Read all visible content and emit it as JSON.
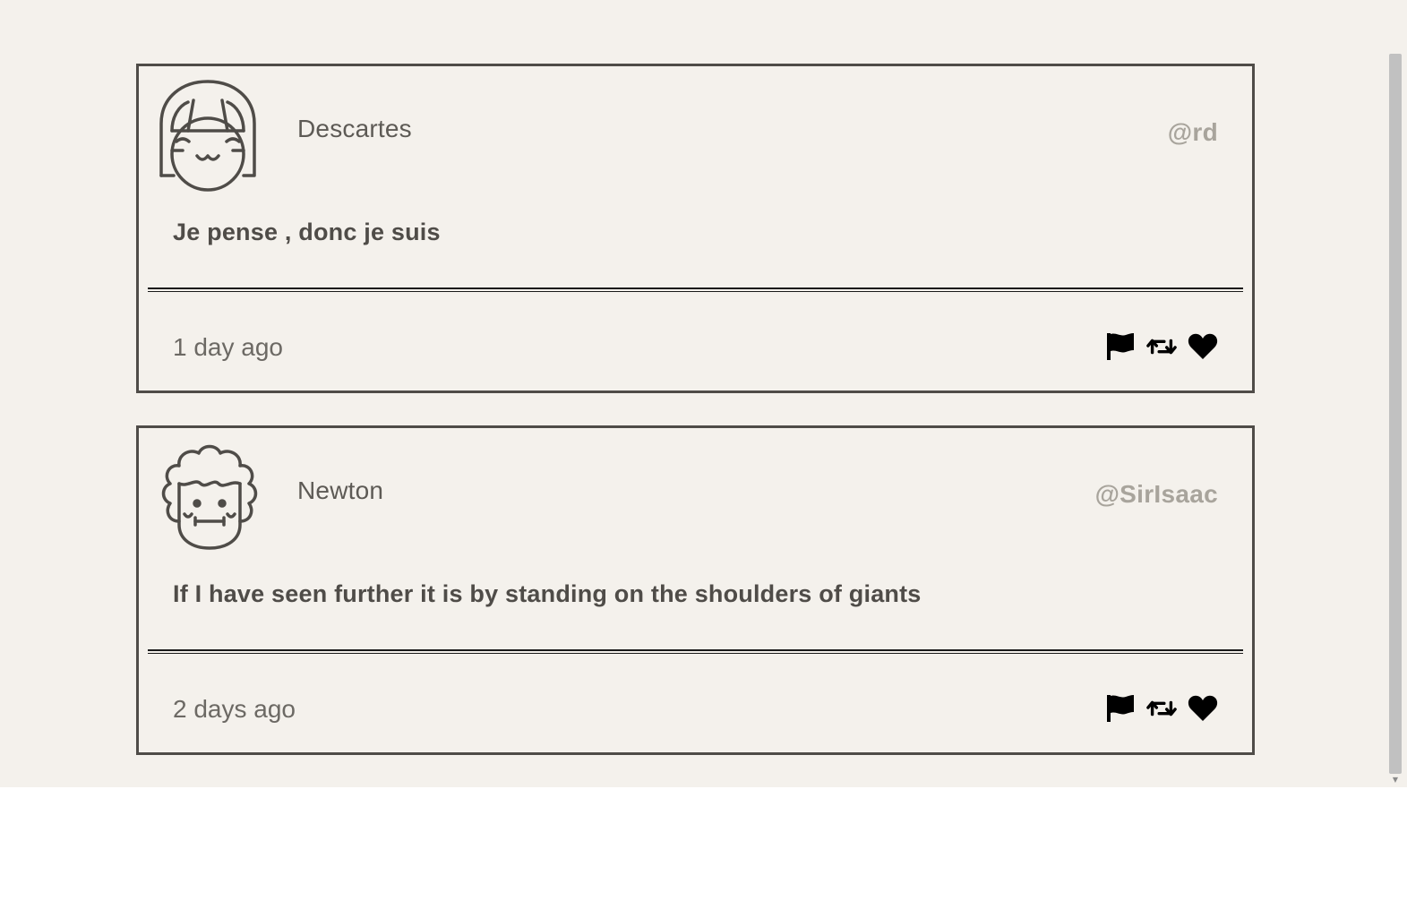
{
  "colors": {
    "background": "#f4f1ec",
    "card_border": "#4f4c48",
    "handle": "#a8a49c",
    "icon": "#000000"
  },
  "tweets": [
    {
      "avatar_icon": "girl-avatar-icon",
      "name": "Descartes",
      "handle": "@rd",
      "text": "Je pense , donc je suis",
      "timestamp": "1 day ago",
      "actions": [
        "flag-icon",
        "retweet-icon",
        "heart-icon"
      ]
    },
    {
      "avatar_icon": "curly-hair-avatar-icon",
      "name": "Newton",
      "handle": "@SirIsaac",
      "text": "If I have seen further it is by standing on the shoulders of giants",
      "timestamp": "2 days ago",
      "actions": [
        "flag-icon",
        "retweet-icon",
        "heart-icon"
      ]
    }
  ]
}
